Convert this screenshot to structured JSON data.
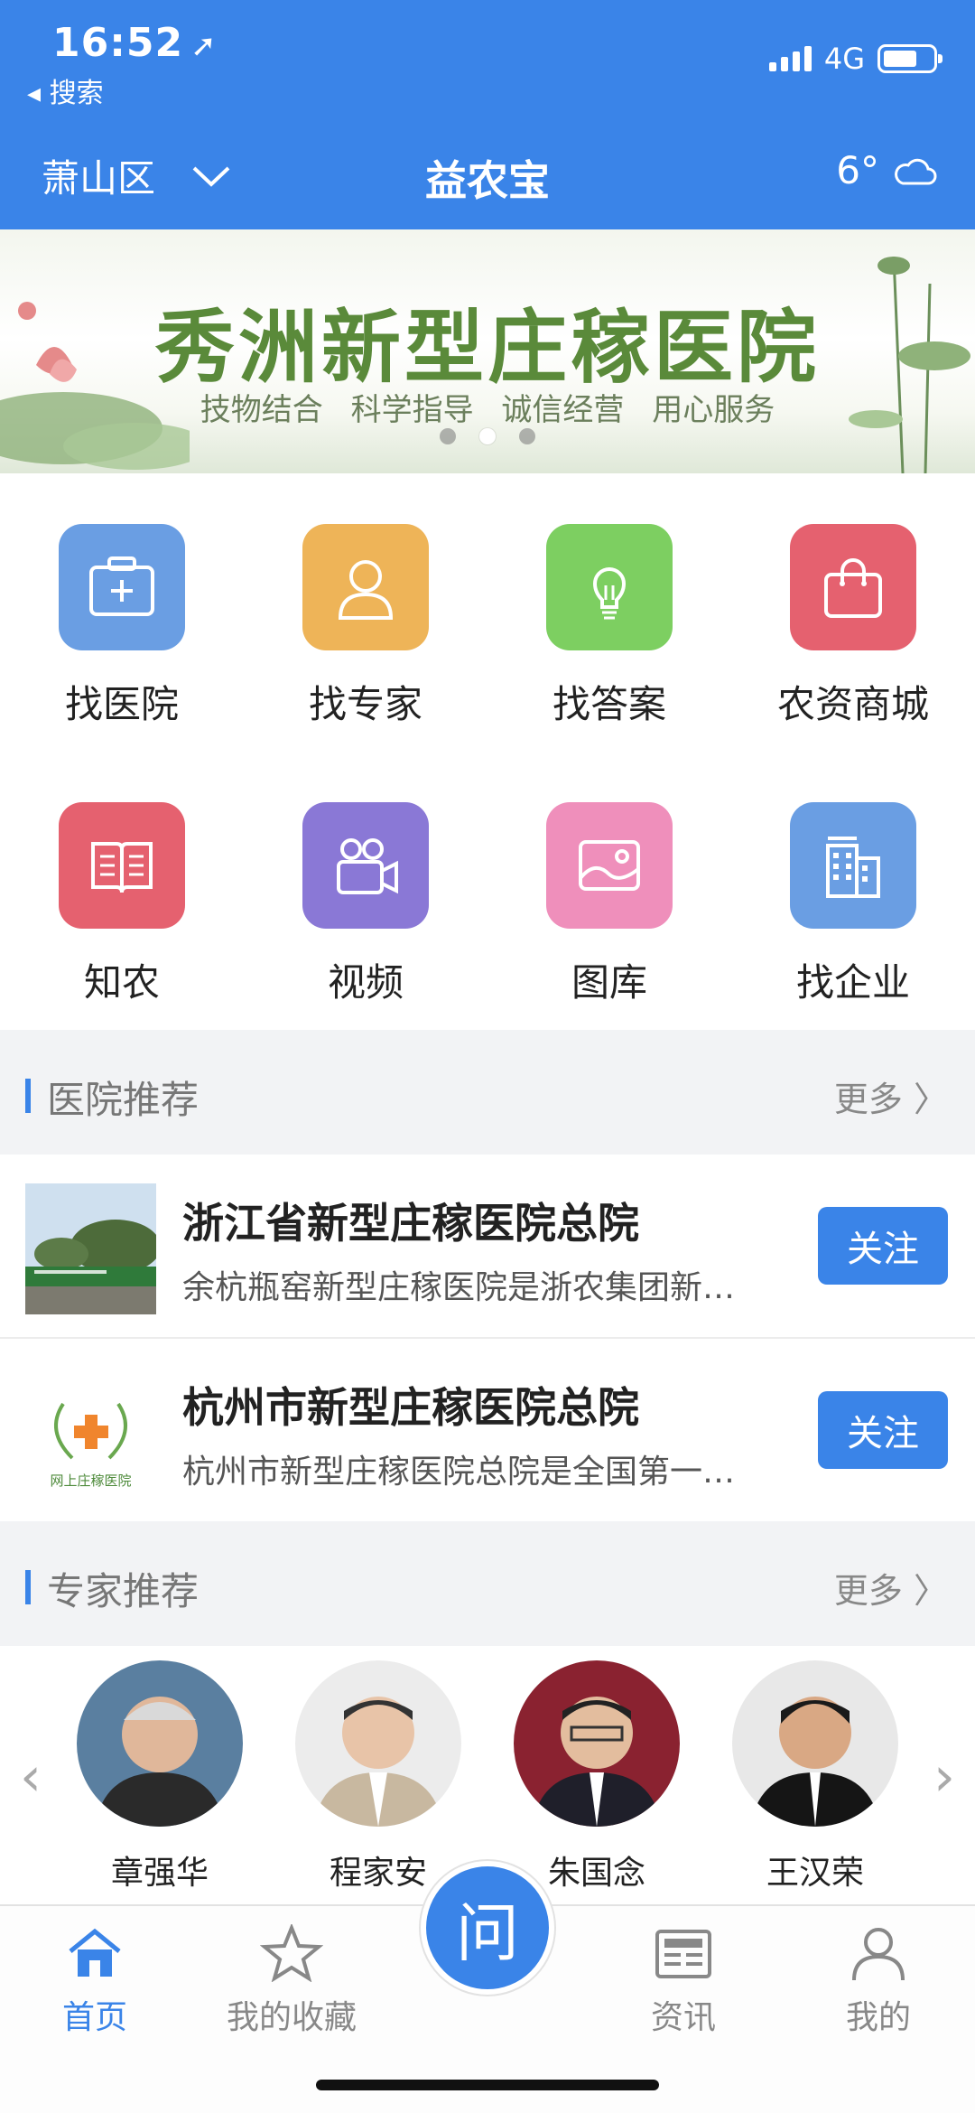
{
  "status": {
    "time": "16:52",
    "back_label": "◂ 搜索",
    "network": "4G"
  },
  "header": {
    "district": "萧山区",
    "title": "益农宝",
    "temperature": "6°"
  },
  "banner": {
    "title": "秀洲新型庄稼医院",
    "subtitle": "技物结合 科学指导 诚信经营 用心服务"
  },
  "grid": [
    {
      "label": "找医院",
      "icon": "medical-kit-icon",
      "color": "#6a9ee3"
    },
    {
      "label": "找专家",
      "icon": "expert-person-icon",
      "color": "#eeb458"
    },
    {
      "label": "找答案",
      "icon": "lightbulb-icon",
      "color": "#7dcf61"
    },
    {
      "label": "农资商城",
      "icon": "shopping-bag-icon",
      "color": "#e5616f"
    },
    {
      "label": "知农",
      "icon": "book-icon",
      "color": "#e5616f"
    },
    {
      "label": "视频",
      "icon": "video-camera-icon",
      "color": "#8a78d6"
    },
    {
      "label": "图库",
      "icon": "picture-icon",
      "color": "#ef8fbb"
    },
    {
      "label": "找企业",
      "icon": "building-icon",
      "color": "#6a9ee3"
    }
  ],
  "hospital_section": {
    "title": "医院推荐",
    "more": "更多 〉"
  },
  "hospitals": [
    {
      "name": "浙江省新型庄稼医院总院",
      "desc": "余杭瓶窑新型庄稼医院是浙农集团新…",
      "follow": "关注"
    },
    {
      "name": "杭州市新型庄稼医院总院",
      "desc": "杭州市新型庄稼医院总院是全国第一…",
      "follow": "关注",
      "logo_text": "网上庄稼医院"
    }
  ],
  "expert_section": {
    "title": "专家推荐",
    "more": "更多 〉"
  },
  "experts": [
    {
      "name": "章强华"
    },
    {
      "name": "程家安"
    },
    {
      "name": "朱国念"
    },
    {
      "name": "王汉荣"
    }
  ],
  "tabs": [
    {
      "label": "首页",
      "icon": "home-icon"
    },
    {
      "label": "我的收藏",
      "icon": "star-icon"
    },
    {
      "label": "资讯",
      "icon": "newspaper-icon"
    },
    {
      "label": "我的",
      "icon": "user-icon"
    }
  ],
  "ask_button": "问"
}
